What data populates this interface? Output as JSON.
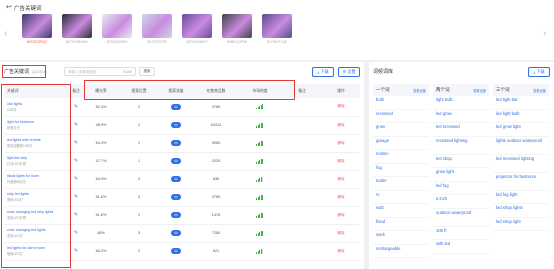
{
  "header": {
    "back_glyph": "↩",
    "title": "广告关键词"
  },
  "products": [
    {
      "asin": "B07GK22RQT",
      "active": true,
      "color": "#3b3a6a"
    },
    {
      "asin": "B07GK2BHWH",
      "active": false,
      "color": "#2c2c3a"
    },
    {
      "asin": "B07KBQ8XRS",
      "active": false,
      "color": "#e6ecf3"
    },
    {
      "asin": "B07JP2G75R",
      "active": false,
      "color": "#cfd7e6"
    },
    {
      "asin": "B07HGCB6PX",
      "active": false,
      "color": "#6b4aa0"
    },
    {
      "asin": "B088CQ3P5D",
      "active": false,
      "color": "#444444"
    },
    {
      "asin": "B07KB7T4Q5",
      "active": false,
      "color": "#5a4e8a"
    }
  ],
  "left": {
    "tab_label": "广告关键词",
    "tab_count": "(111/374)",
    "search_placeholder": "请输入关键词搜索",
    "search_count": "0/100",
    "search_button": "搜索",
    "download_label": "下载",
    "settings_label": "设置",
    "columns": [
      "关键词",
      "备注",
      "曝光率",
      "搜索位置",
      "搜索流量",
      "在售商品数",
      "市场热度",
      "备注",
      "操作"
    ],
    "rows": [
      {
        "en": "usb lights",
        "cn": "USB灯",
        "ratio": "82.4%",
        "pos": "2",
        "pill": "中",
        "count": "3785",
        "heat": 5,
        "op": "移除"
      },
      {
        "en": "light for bedroom",
        "cn": "卧室灯光",
        "ratio": "48.9%",
        "pos": "2",
        "pill": "中",
        "count": "64312",
        "heat": 5,
        "op": "移除"
      },
      {
        "en": "led lights with remote",
        "cn": "带遥控器的LED灯",
        "ratio": "64.3%",
        "pos": "1",
        "pill": "中",
        "count": "9065",
        "heat": 5,
        "op": "移除"
      },
      {
        "en": "light led strip",
        "cn": "灯光LED灯带",
        "ratio": "47.7%",
        "pos": "1",
        "pill": "中",
        "count": "2025",
        "heat": 5,
        "op": "移除"
      },
      {
        "en": "tiktok lights for room",
        "cn": "抖音房间灯光",
        "ratio": "64.9%",
        "pos": "3",
        "pill": "中",
        "count": "836",
        "heat": 4,
        "op": "移除"
      },
      {
        "en": "strip led lights",
        "cn": "条形LED灯",
        "ratio": "61.6%",
        "pos": "3",
        "pill": "中",
        "count": "3760",
        "heat": 5,
        "op": "移除"
      },
      {
        "en": "color changing led strip lights",
        "cn": "变色LED灯带",
        "ratio": "61.6%",
        "pos": "2",
        "pill": "中",
        "count": "1478",
        "heat": 5,
        "op": "移除"
      },
      {
        "en": "color changing led lights",
        "cn": "变色LED灯",
        "ratio": "48%",
        "pos": "3",
        "pill": "中",
        "count": "7280",
        "heat": 5,
        "op": "移除"
      },
      {
        "en": "led lights for dorm room",
        "cn": "宿舍LED灯",
        "ratio": "66.2%",
        "pos": "2",
        "pill": "中",
        "count": "621",
        "heat": 4,
        "op": "移除"
      }
    ]
  },
  "right": {
    "title": "词频词库",
    "download_label": "下载",
    "columns": [
      {
        "name": "一个词",
        "all": "查看全部",
        "words": [
          "bulb",
          "recessed",
          "grow",
          "garage",
          "motion",
          "fog",
          "trailer",
          "rv",
          "watt",
          "flood",
          "work",
          "rechargeable"
        ]
      },
      {
        "name": "两个词",
        "all": "查看全部",
        "words": [
          "light bulb",
          "led grow",
          "led recessed",
          "recessed lighting",
          "led shop",
          "grow light",
          "led fog",
          "6 inch",
          "outdoor waterproof",
          "100 ft",
          "with led"
        ]
      },
      {
        "name": "三个词",
        "all": "查看全部",
        "words": [
          "led light bar",
          "led light bulb",
          "led grow light",
          "lights outdoor waterproof",
          "led recessed lighting",
          "projector for bedroom",
          "led fog light",
          "led shop lights",
          "led shop light"
        ]
      }
    ]
  }
}
